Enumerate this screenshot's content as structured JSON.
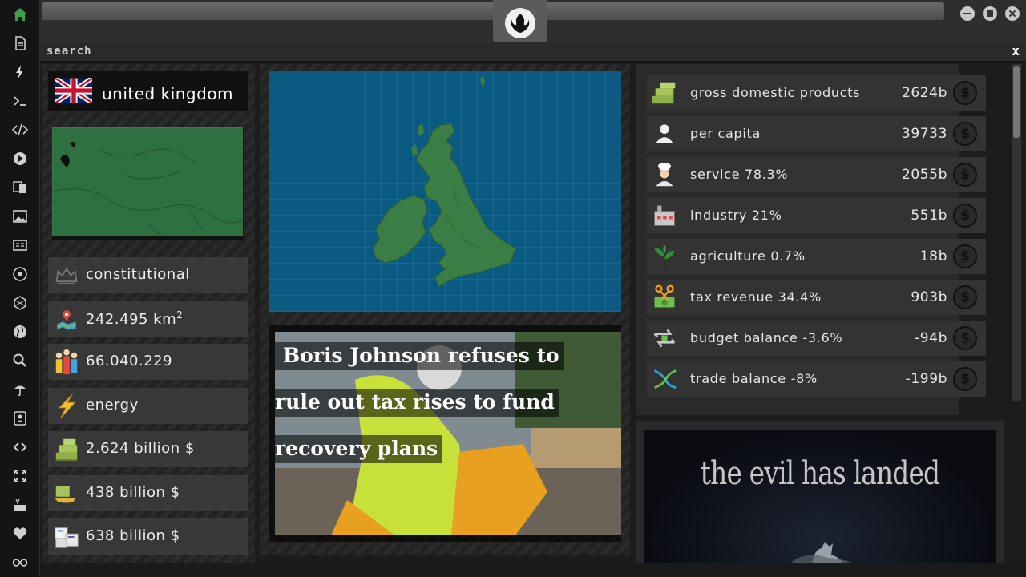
{
  "search": {
    "label": "search",
    "close_label": "x"
  },
  "country": {
    "name": "united kingdom",
    "stats": [
      {
        "icon": "crown-icon",
        "text": "constitutional"
      },
      {
        "icon": "area-map-icon",
        "text": "242.495 km",
        "sup": "2"
      },
      {
        "icon": "population-icon",
        "text": "66.040.229"
      },
      {
        "icon": "lightning-icon",
        "text": "energy"
      },
      {
        "icon": "money-stack-icon",
        "text": "2.624 billion $"
      },
      {
        "icon": "money-cart-icon",
        "text": "438 billion $"
      },
      {
        "icon": "package-boxes-icon",
        "text": "638 billion $"
      }
    ]
  },
  "news": {
    "headline_lines": [
      "Boris Johnson refuses to",
      "rule out tax rises to fund",
      "recovery plans"
    ]
  },
  "economy": [
    {
      "icon": "money-pallet-icon",
      "label": "gross domestic products",
      "value": "2624b"
    },
    {
      "icon": "person-icon",
      "label": "per capita",
      "value": "39733"
    },
    {
      "icon": "chef-icon",
      "label": "service 78.3%",
      "value": "2055b"
    },
    {
      "icon": "factory-icon",
      "label": "industry 21%",
      "value": "551b"
    },
    {
      "icon": "plant-icon",
      "label": "agriculture 0.7%",
      "value": "18b"
    },
    {
      "icon": "scissors-money-icon",
      "label": "tax revenue 34.4%",
      "value": "903b"
    },
    {
      "icon": "balance-arrows-icon",
      "label": "budget balance -3.6%",
      "value": "-94b"
    },
    {
      "icon": "trade-cross-icon",
      "label": "trade balance -8%",
      "value": "-199b"
    }
  ],
  "coin_symbol": "$",
  "ad": {
    "headline": "the evil has landed"
  },
  "colors": {
    "map_ocean": "#0b5a82",
    "land": "#2f7040",
    "panel": "#383838",
    "accent_green": "#3aa14c"
  }
}
